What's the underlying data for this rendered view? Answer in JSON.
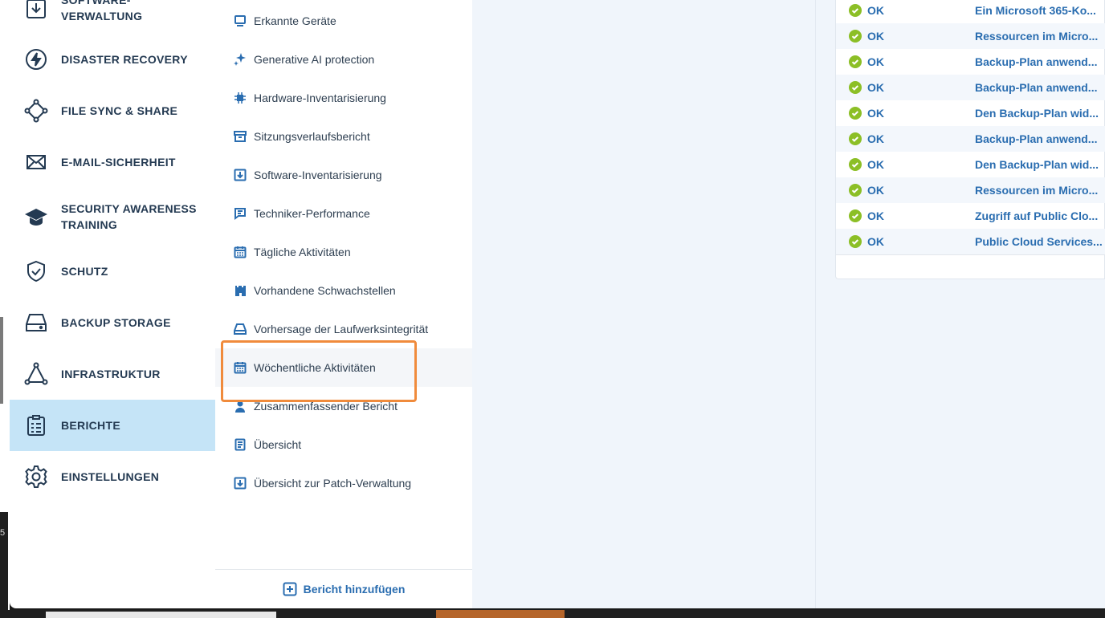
{
  "primary_nav": {
    "items": [
      {
        "label": "SOFTWARE-\nVERWALTUNG",
        "line1": "SOFTWARE-",
        "line2": "VERWALTUNG",
        "icon": "download-box-icon"
      },
      {
        "label": "DISASTER RECOVERY",
        "icon": "lightning-icon"
      },
      {
        "label": "FILE SYNC & SHARE",
        "icon": "sync-share-icon"
      },
      {
        "label": "E-MAIL-SICHERHEIT",
        "icon": "envelope-icon"
      },
      {
        "label1": "SECURITY AWARENESS",
        "label2": "TRAINING",
        "icon": "graduation-cap-icon"
      },
      {
        "label": "SCHUTZ",
        "icon": "shield-icon"
      },
      {
        "label": "BACKUP STORAGE",
        "icon": "drive-icon"
      },
      {
        "label": "INFRASTRUKTUR",
        "icon": "triangle-nodes-icon"
      },
      {
        "label": "BERICHTE",
        "icon": "clipboard-icon",
        "active": true
      },
      {
        "label": "EINSTELLUNGEN",
        "icon": "gear-icon"
      }
    ]
  },
  "reports": {
    "items": [
      {
        "label": "Erkannte Geräte",
        "icon": "monitor-icon"
      },
      {
        "label": "Generative AI protection",
        "icon": "sparkle-icon"
      },
      {
        "label": "Hardware-Inventarisierung",
        "icon": "chip-icon"
      },
      {
        "label": "Sitzungsverlaufsbericht",
        "icon": "archive-icon"
      },
      {
        "label": "Software-Inventarisierung",
        "icon": "download-square-icon"
      },
      {
        "label": "Techniker-Performance",
        "icon": "comment-icon"
      },
      {
        "label": "Tägliche Aktivitäten",
        "icon": "calendar-icon"
      },
      {
        "label": "Vorhandene Schwachstellen",
        "icon": "castle-icon"
      },
      {
        "label": "Vorhersage der Laufwerksintegrität",
        "icon": "disk-icon"
      },
      {
        "label": "Wöchentliche Aktivitäten",
        "icon": "calendar-icon",
        "highlighted": true
      },
      {
        "label": "Zusammenfassender Bericht",
        "icon": "user-icon"
      },
      {
        "label": "Übersicht",
        "icon": "document-icon"
      },
      {
        "label": "Übersicht zur Patch-Verwaltung",
        "icon": "download-square-icon"
      }
    ],
    "add_label": "Bericht hinzufügen"
  },
  "activity_table": {
    "rows": [
      {
        "status": "OK",
        "activity": "Ein Microsoft 365-Ko..."
      },
      {
        "status": "OK",
        "activity": "Ressourcen im Micro..."
      },
      {
        "status": "OK",
        "activity": "Backup-Plan anwend..."
      },
      {
        "status": "OK",
        "activity": "Backup-Plan anwend..."
      },
      {
        "status": "OK",
        "activity": "Den Backup-Plan wid..."
      },
      {
        "status": "OK",
        "activity": "Backup-Plan anwend..."
      },
      {
        "status": "OK",
        "activity": "Den Backup-Plan wid..."
      },
      {
        "status": "OK",
        "activity": "Ressourcen im Micro..."
      },
      {
        "status": "OK",
        "activity": "Zugriff auf Public Clo..."
      },
      {
        "status": "OK",
        "activity": "Public Cloud Services..."
      }
    ]
  },
  "colors": {
    "accent": "#2a6db0",
    "nav_text": "#243a52",
    "active_bg": "#c5e4f7",
    "highlight": "#f08b3c",
    "ok_green": "#8cbf26"
  }
}
